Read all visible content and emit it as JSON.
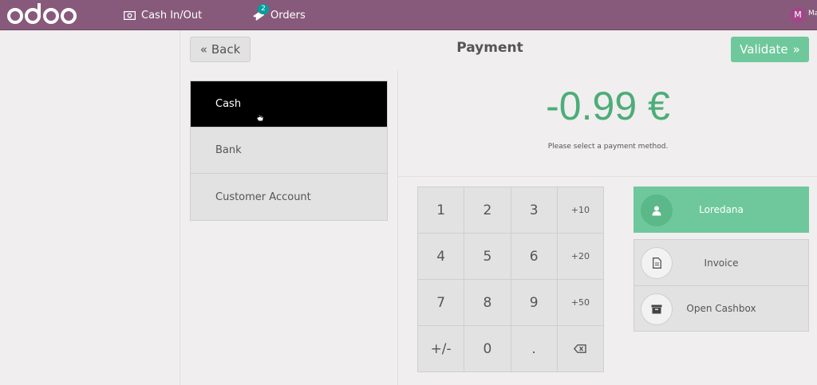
{
  "topbar": {
    "logo_text": "odoo",
    "cash_in_out": "Cash In/Out",
    "orders": "Orders",
    "orders_badge": "2",
    "user_initial": "M",
    "user_name": "Ma"
  },
  "header": {
    "back_label": "Back",
    "title": "Payment",
    "validate_label": "Validate"
  },
  "payment_methods": [
    "Cash",
    "Bank",
    "Customer Account"
  ],
  "selected_method": "Cash",
  "amount": "-0.99 €",
  "hint": "Please select a payment method.",
  "numpad": {
    "keys": [
      "1",
      "2",
      "3",
      "+10",
      "4",
      "5",
      "6",
      "+20",
      "7",
      "8",
      "9",
      "+50",
      "+/-",
      "0",
      ".",
      ""
    ]
  },
  "actions": {
    "customer": "Loredana",
    "invoice": "Invoice",
    "cashbox": "Open Cashbox"
  },
  "colors": {
    "topbar": "#875a7b",
    "accent_green": "#6ec89b",
    "amount_green": "#4cad78"
  },
  "icons": {
    "cash": "cash-icon",
    "orders": "ticket-icon",
    "customer": "user-icon",
    "invoice": "document-icon",
    "cashbox": "archive-box-icon",
    "backspace": "backspace-icon"
  }
}
